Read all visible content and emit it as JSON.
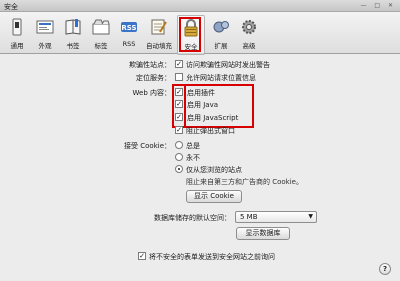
{
  "window": {
    "title": "安全",
    "controls": "— □ ✕"
  },
  "toolbar": {
    "items": [
      {
        "label": "通用",
        "icon": "switch-icon"
      },
      {
        "label": "外观",
        "icon": "appearance-icon"
      },
      {
        "label": "书签",
        "icon": "bookmarks-icon"
      },
      {
        "label": "标签",
        "icon": "tabs-icon"
      },
      {
        "label": "RSS",
        "icon": "rss-icon"
      },
      {
        "label": "自动填充",
        "icon": "autofill-icon"
      },
      {
        "label": "安全",
        "icon": "lock-icon",
        "selected": true
      },
      {
        "label": "扩展",
        "icon": "extensions-icon"
      },
      {
        "label": "高级",
        "icon": "gear-icon"
      }
    ]
  },
  "security": {
    "fraud": {
      "label": "欺骗性站点：",
      "option": "访问欺骗性网站时发出警告",
      "checked": true
    },
    "location": {
      "label": "定位服务：",
      "option": "允许网站请求位置信息",
      "checked": false
    },
    "web_content": {
      "label": "Web 内容：",
      "options": [
        {
          "text": "启用插件",
          "checked": true
        },
        {
          "text": "启用 Java",
          "checked": true
        },
        {
          "text": "启用 JavaScript",
          "checked": true
        },
        {
          "text": "阻止弹出式窗口",
          "checked": true
        }
      ]
    },
    "cookies": {
      "label": "接受 Cookie：",
      "options": [
        {
          "text": "总是",
          "selected": false
        },
        {
          "text": "永不",
          "selected": false
        },
        {
          "text": "仅从您浏览的站点",
          "selected": true
        }
      ],
      "note": "阻止来自第三方和广告商的 Cookie。",
      "show_button": "显示 Cookie"
    },
    "database": {
      "label": "数据库储存的默认空间：",
      "size": "5 MB",
      "show_button": "显示数据库"
    },
    "form_warning": {
      "text": "将不安全的表单发送到安全网站之前询问",
      "checked": true
    }
  },
  "help": {
    "glyph": "?"
  },
  "colors": {
    "highlight": "#d60000",
    "background": "#ececec"
  }
}
